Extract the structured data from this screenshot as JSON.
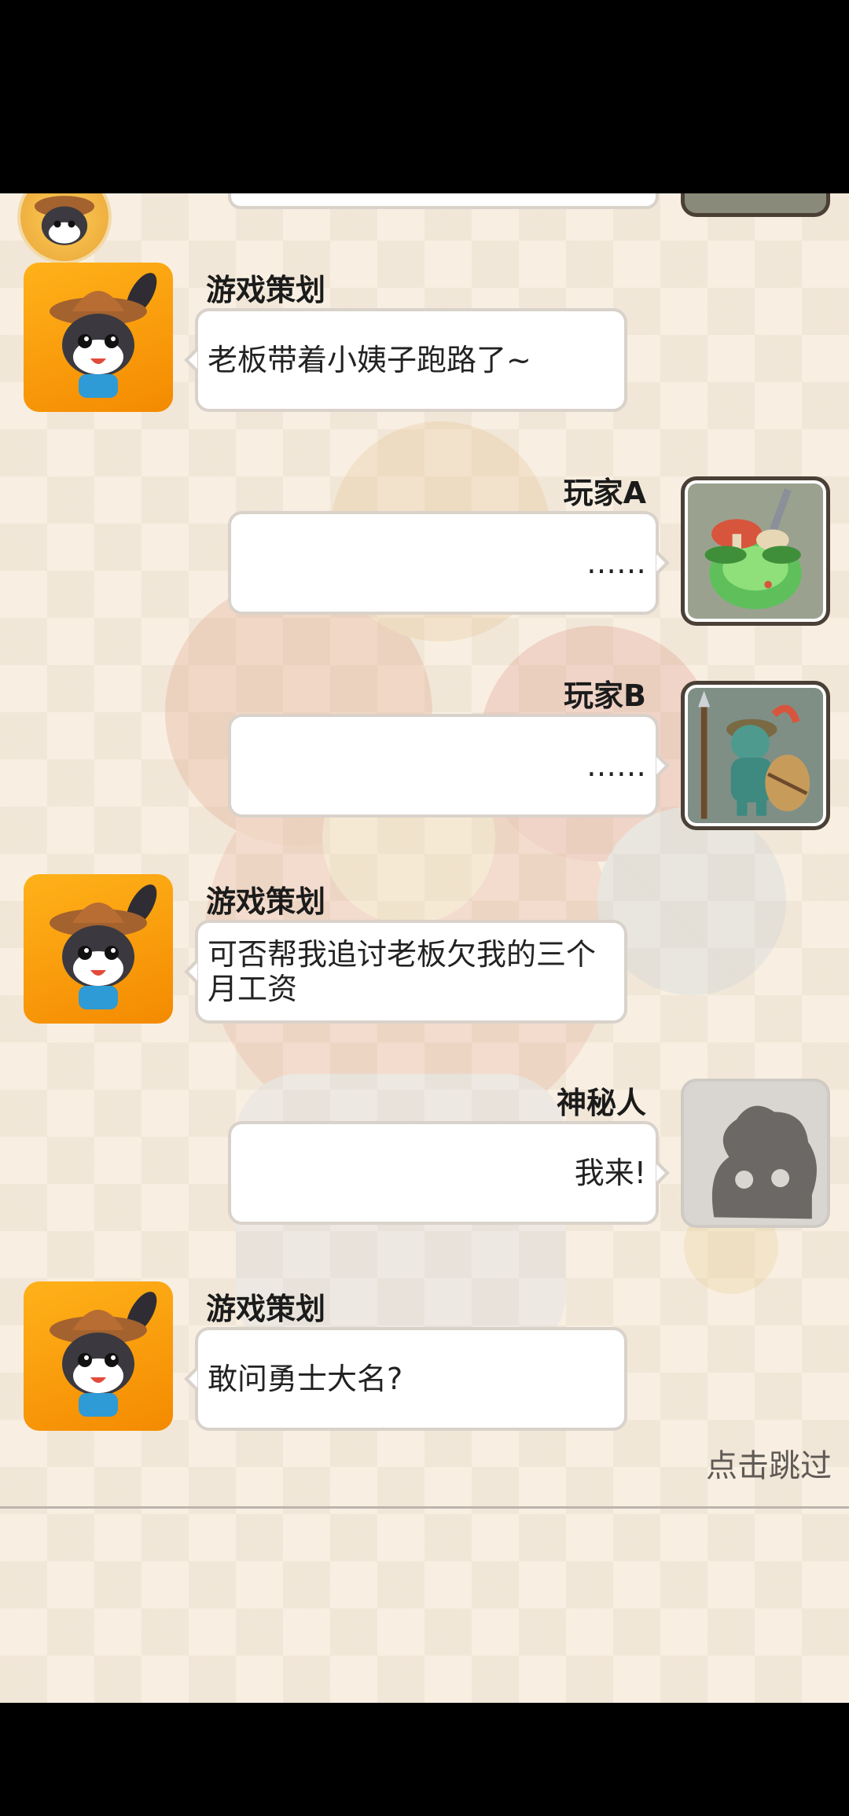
{
  "messages": [
    {
      "speaker": "游戏策划",
      "text": "老板带着小姨子跑路了~",
      "side": "left"
    },
    {
      "speaker": "玩家A",
      "text": "……",
      "side": "right"
    },
    {
      "speaker": "玩家B",
      "text": "……",
      "side": "right"
    },
    {
      "speaker": "游戏策划",
      "text": "可否帮我追讨老板欠我的三个月工资",
      "side": "left"
    },
    {
      "speaker": "神秘人",
      "text": "我来!",
      "side": "right"
    },
    {
      "speaker": "游戏策划",
      "text": "敢问勇士大名?",
      "side": "left"
    }
  ],
  "skip_label": "点击跳过",
  "avatars": {
    "planner": "bunny-cowboy-icon",
    "playerA": "mushroom-slime-icon",
    "playerB": "goblin-warrior-icon",
    "mystery": "silhouette-icon"
  },
  "colors": {
    "accent": "#f48a00",
    "background": "#f8efe2",
    "bubble_border": "#d9d2cb"
  }
}
